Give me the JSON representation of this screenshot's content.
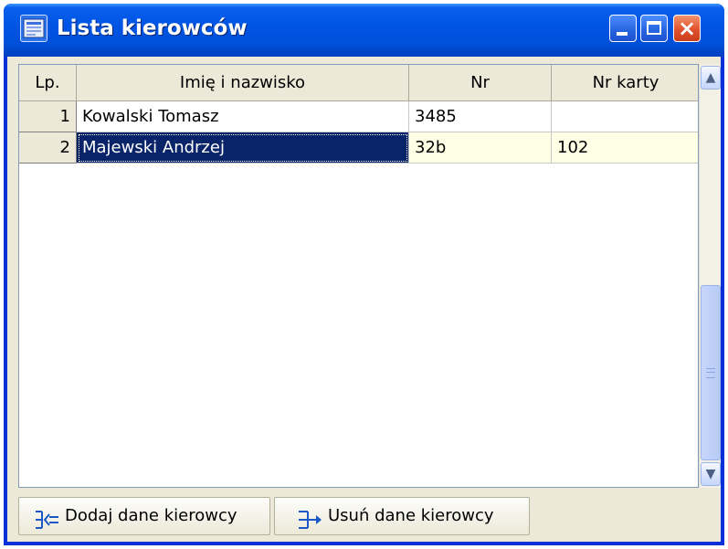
{
  "window": {
    "title": "Lista kierowców",
    "icon": "app-icon",
    "controls": [
      "minimize-icon",
      "maximize-icon",
      "close-icon"
    ],
    "colors": {
      "titlebar": "#0055e5",
      "selection": "#0a246a",
      "alt_row": "#ffffe6"
    }
  },
  "table": {
    "columns": [
      "Lp.",
      "Imię i nazwisko",
      "Nr",
      "Nr karty"
    ],
    "rows": [
      {
        "lp": "1",
        "name": "Kowalski Tomasz",
        "nr": "3485",
        "card": ""
      },
      {
        "lp": "2",
        "name": "Majewski Andrzej",
        "nr": "32b",
        "card": "102"
      }
    ],
    "selected_row": 2
  },
  "buttons": {
    "add": {
      "label": "Dodaj dane kierowcy",
      "icon": "add-record-icon"
    },
    "remove": {
      "label": "Usuń dane kierowcy",
      "icon": "remove-record-icon"
    }
  }
}
